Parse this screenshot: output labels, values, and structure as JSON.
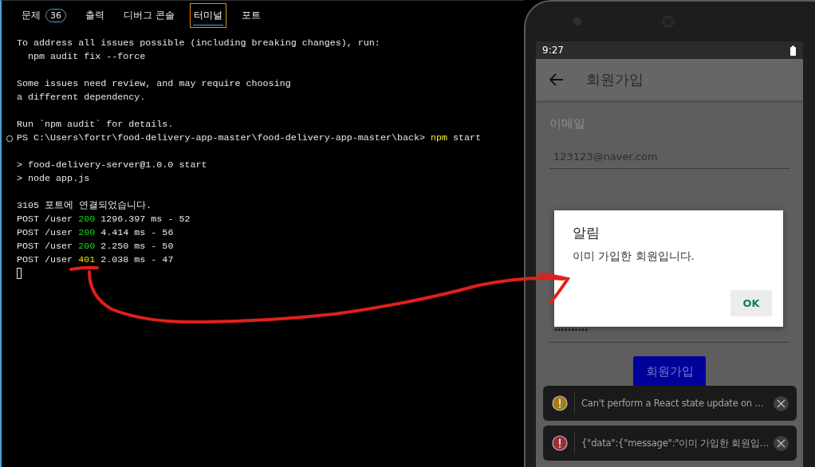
{
  "panel_tabs": [
    {
      "label": "문제",
      "badge": "36",
      "selected": false
    },
    {
      "label": "출력",
      "selected": false
    },
    {
      "label": "디버그 콘솔",
      "selected": false
    },
    {
      "label": "터미널",
      "selected": true
    },
    {
      "label": "포트",
      "selected": false
    }
  ],
  "terminal": {
    "lines": [
      {
        "kind": "text",
        "spans": [
          {
            "kind": "plain",
            "text": "To address all issues possible (including breaking changes), run:"
          }
        ]
      },
      {
        "kind": "text",
        "spans": [
          {
            "kind": "plain",
            "text": "  npm audit fix --force"
          }
        ]
      },
      {
        "kind": "blank"
      },
      {
        "kind": "text",
        "spans": [
          {
            "kind": "plain",
            "text": "Some issues need review, and may require choosing"
          }
        ]
      },
      {
        "kind": "text",
        "spans": [
          {
            "kind": "plain",
            "text": "a different dependency."
          }
        ]
      },
      {
        "kind": "blank"
      },
      {
        "kind": "text",
        "spans": [
          {
            "kind": "plain",
            "text": "Run `npm audit` for details."
          }
        ]
      },
      {
        "kind": "prompt",
        "spans": [
          {
            "kind": "plain",
            "text": "PS C:\\Users\\fortr\\food-delivery-app-master\\food-delivery-app-master\\back> "
          },
          {
            "kind": "command",
            "text": "npm"
          },
          {
            "kind": "plain",
            "text": " start"
          }
        ]
      },
      {
        "kind": "blank"
      },
      {
        "kind": "text",
        "spans": [
          {
            "kind": "plain",
            "text": "> food-delivery-server@1.0.0 start"
          }
        ]
      },
      {
        "kind": "text",
        "spans": [
          {
            "kind": "plain",
            "text": "> node app.js"
          }
        ]
      },
      {
        "kind": "blank"
      },
      {
        "kind": "text",
        "spans": [
          {
            "kind": "plain",
            "text": "3105 포트에 연결되었습니다."
          }
        ]
      },
      {
        "kind": "text",
        "spans": [
          {
            "kind": "plain",
            "text": "POST /user "
          },
          {
            "kind": "success",
            "text": "200"
          },
          {
            "kind": "plain",
            "text": " 1296.397 ms - 52"
          }
        ]
      },
      {
        "kind": "text",
        "spans": [
          {
            "kind": "plain",
            "text": "POST /user "
          },
          {
            "kind": "success",
            "text": "200"
          },
          {
            "kind": "plain",
            "text": " 4.414 ms - 56"
          }
        ]
      },
      {
        "kind": "text",
        "spans": [
          {
            "kind": "plain",
            "text": "POST /user "
          },
          {
            "kind": "success",
            "text": "200"
          },
          {
            "kind": "plain",
            "text": " 2.250 ms - 50"
          }
        ]
      },
      {
        "kind": "text",
        "spans": [
          {
            "kind": "plain",
            "text": "POST /user "
          },
          {
            "kind": "warning",
            "text": "401"
          },
          {
            "kind": "plain",
            "text": " 2.038 ms - 47"
          }
        ]
      },
      {
        "kind": "cursor"
      }
    ]
  },
  "phone": {
    "status_bar": {
      "time": "9:27"
    },
    "app_bar": {
      "title": "회원가입"
    },
    "form": {
      "email_label": "이메일",
      "email_value": "123123@naver.com",
      "password_value": "••••••••••",
      "submit_button": "회원가입"
    },
    "dialog": {
      "title": "알림",
      "message": "이미 가입한 회원입니다.",
      "button": "OK"
    },
    "toasts": [
      {
        "kind": "warning",
        "text": "Can't perform a React state update on …"
      },
      {
        "kind": "error",
        "text": "{\"data\":{\"message\":\"이미 가입한 회원입…"
      }
    ]
  }
}
